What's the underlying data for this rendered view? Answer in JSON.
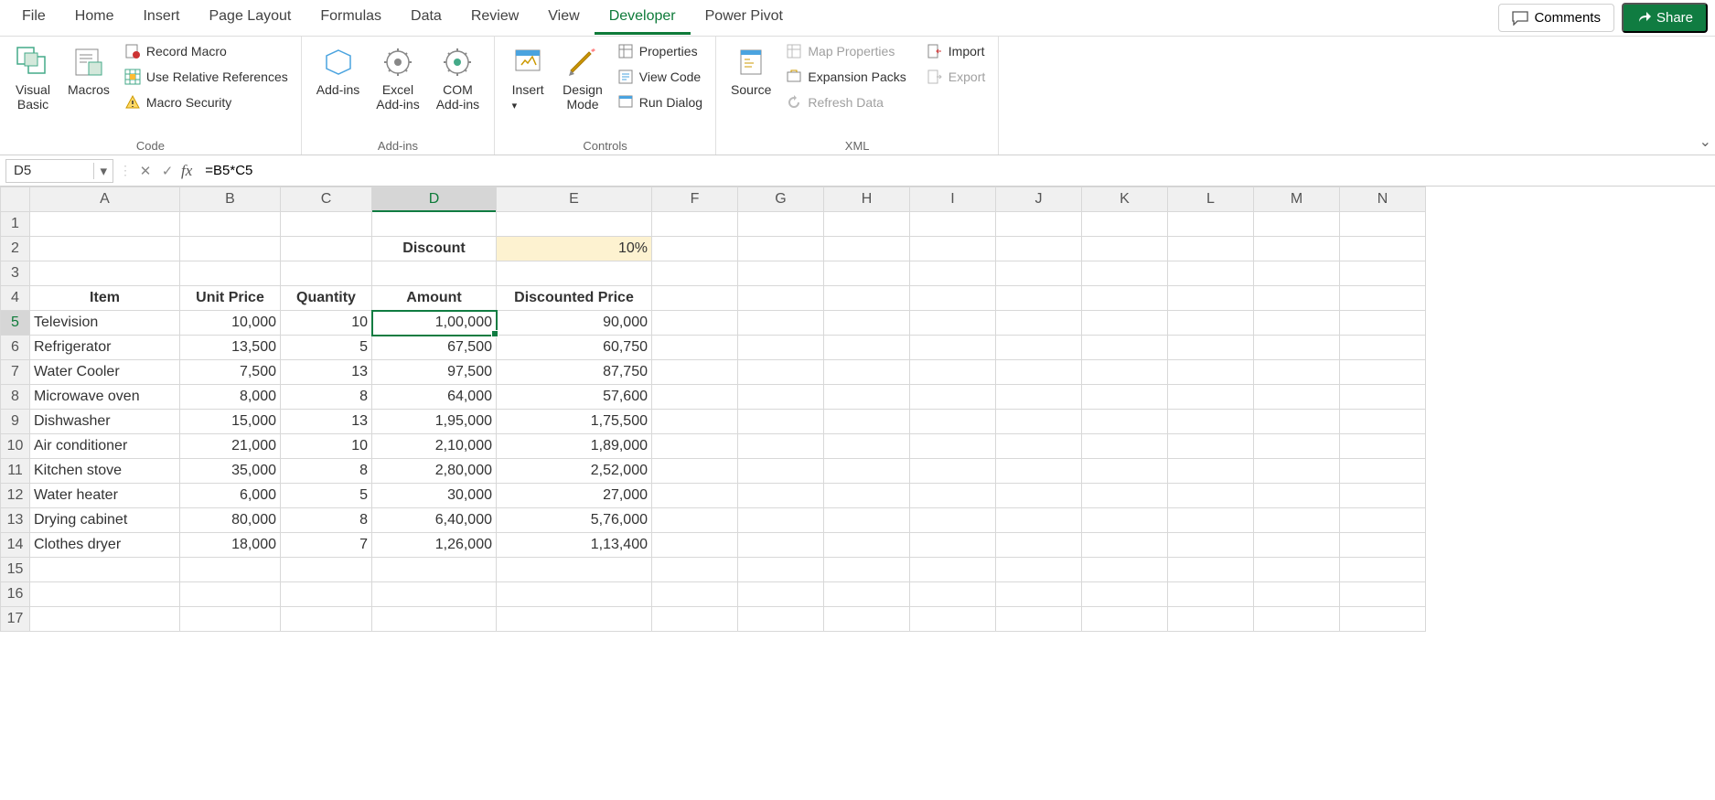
{
  "menu": {
    "items": [
      "File",
      "Home",
      "Insert",
      "Page Layout",
      "Formulas",
      "Data",
      "Review",
      "View",
      "Developer",
      "Power Pivot"
    ],
    "activeIndex": 8,
    "comments": "Comments",
    "share": "Share"
  },
  "ribbon": {
    "code": {
      "visualBasic": "Visual Basic",
      "macros": "Macros",
      "recordMacro": "Record Macro",
      "useRelative": "Use Relative References",
      "macroSecurity": "Macro Security",
      "label": "Code"
    },
    "addins": {
      "addins": "Add-ins",
      "excel": "Excel Add-ins",
      "com": "COM Add-ins",
      "label": "Add-ins"
    },
    "controls": {
      "insert": "Insert",
      "design": "Design Mode",
      "properties": "Properties",
      "viewCode": "View Code",
      "runDialog": "Run Dialog",
      "label": "Controls"
    },
    "xml": {
      "source": "Source",
      "mapProps": "Map Properties",
      "expansion": "Expansion Packs",
      "refresh": "Refresh Data",
      "import": "Import",
      "export": "Export",
      "label": "XML"
    }
  },
  "formulaBar": {
    "cellRef": "D5",
    "formula": "=B5*C5"
  },
  "sheet": {
    "columns": [
      "A",
      "B",
      "C",
      "D",
      "E",
      "F",
      "G",
      "H",
      "I",
      "J",
      "K",
      "L",
      "M",
      "N"
    ],
    "selectedCol": "D",
    "selectedRow": 5,
    "discountLabel": "Discount",
    "discountValue": "10%",
    "headers": [
      "Item",
      "Unit Price",
      "Quantity",
      "Amount",
      "Discounted Price"
    ],
    "rows": [
      {
        "item": "Television",
        "unit": "10,000",
        "qty": "10",
        "amt": "1,00,000",
        "disc": "90,000"
      },
      {
        "item": "Refrigerator",
        "unit": "13,500",
        "qty": "5",
        "amt": "67,500",
        "disc": "60,750"
      },
      {
        "item": "Water Cooler",
        "unit": "7,500",
        "qty": "13",
        "amt": "97,500",
        "disc": "87,750"
      },
      {
        "item": "Microwave oven",
        "unit": "8,000",
        "qty": "8",
        "amt": "64,000",
        "disc": "57,600"
      },
      {
        "item": "Dishwasher",
        "unit": "15,000",
        "qty": "13",
        "amt": "1,95,000",
        "disc": "1,75,500"
      },
      {
        "item": "Air conditioner",
        "unit": "21,000",
        "qty": "10",
        "amt": "2,10,000",
        "disc": "1,89,000"
      },
      {
        "item": "Kitchen stove",
        "unit": "35,000",
        "qty": "8",
        "amt": "2,80,000",
        "disc": "2,52,000"
      },
      {
        "item": "Water heater",
        "unit": "6,000",
        "qty": "5",
        "amt": "30,000",
        "disc": "27,000"
      },
      {
        "item": "Drying cabinet",
        "unit": "80,000",
        "qty": "8",
        "amt": "6,40,000",
        "disc": "5,76,000"
      },
      {
        "item": "Clothes dryer",
        "unit": "18,000",
        "qty": "7",
        "amt": "1,26,000",
        "disc": "1,13,400"
      }
    ],
    "emptyRowsAfter": 3
  }
}
